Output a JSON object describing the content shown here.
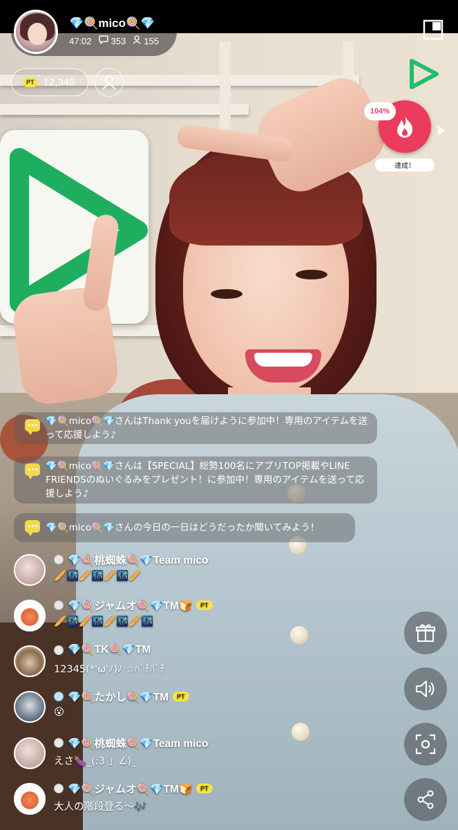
{
  "header": {
    "streamer_name": "💎🍭mico🍭💎",
    "elapsed": "47:02",
    "comment_count": "353",
    "viewer_count": "155"
  },
  "points": {
    "badge": "PT",
    "value": "12,345"
  },
  "event": {
    "progress_label": "104%",
    "status": "達成！"
  },
  "system_messages": [
    {
      "text": "💎🍭mico🍭💎さんはThank youを届けように参加中！専用のアイテムを送って応援しよう♪"
    },
    {
      "text": "💎🍭mico🍭💎さんは【SPECIAL】総勢100名にアプリTOP掲載やLINE FRIENDSのぬいぐるみをプレゼント！に参加中！専用のアイテムを送って応援しよう♪"
    },
    {
      "text": "💎🍭mico🍭💎さんの今日の一日はどうだったか聞いてみよう！"
    }
  ],
  "comments": [
    {
      "name": "💎🍭桃蜘蛛🍭💎Team mico",
      "text": "🥖🌃🥖🌃🥖🌃🥖",
      "pt": ""
    },
    {
      "name": "💎🍭ジャムオ🍭💎TM🍞",
      "text": "🥖🌃🥖🌃🥖🌃🥖🌃",
      "pt": "PT"
    },
    {
      "name": "💎🍭TK🍭💎TM",
      "text": "12345(*'ω'ﾉ)ﾉ ☆ﾊﾟﾁﾊﾟﾁ",
      "pt": ""
    },
    {
      "name": "💎🍭たかし🍭💎TM",
      "text": "😮",
      "pt": "PT"
    },
    {
      "name": "💎🍭桃蜘蛛🍭💎Team mico",
      "text": "えさ🍆_(:3 」∠)_",
      "pt": ""
    },
    {
      "name": "💎🍭ジャムオ🍭💎TM🍞",
      "text": "大人の階段登る〜🎶",
      "pt": "PT"
    }
  ],
  "icons": {
    "comment": "speech-bubble-icon",
    "viewer": "person-icon",
    "gift": "gift-icon",
    "sound": "speaker-icon",
    "capture": "screenshot-icon",
    "share": "share-icon",
    "fire": "flame-icon"
  },
  "colors": {
    "accent_red": "#ec3b5c",
    "brand_green": "#1fbf6a",
    "pt_yellow": "#f7e34b"
  }
}
